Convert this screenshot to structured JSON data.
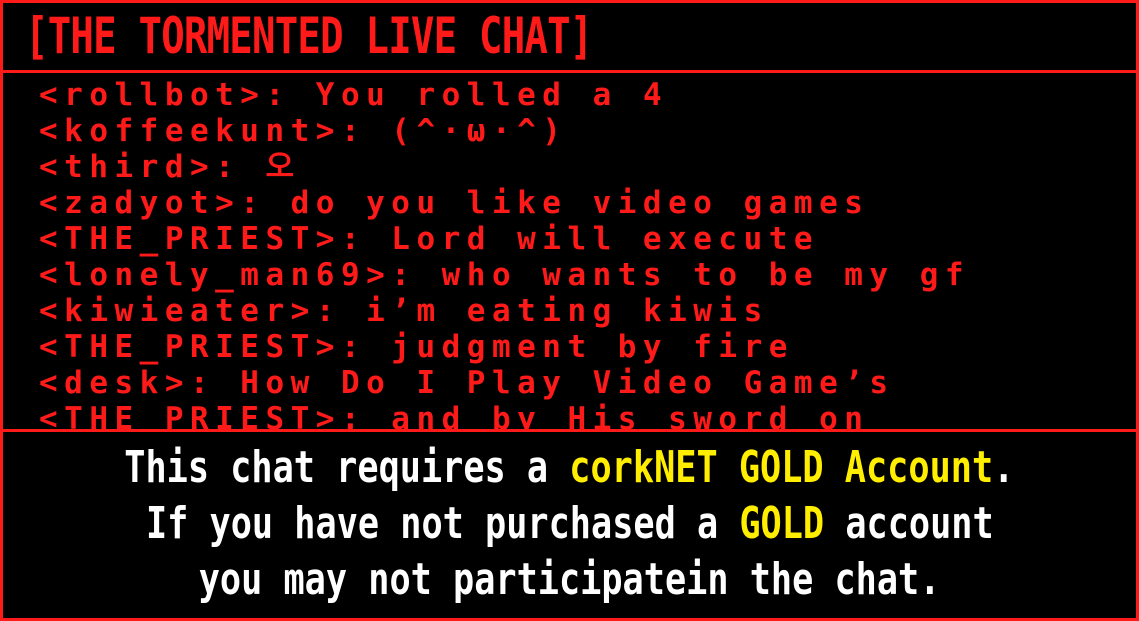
{
  "title": "[THE TORMENTED LIVE CHAT]",
  "messages": [
    {
      "user": "<rollbot>",
      "text": ": You rolled a 4"
    },
    {
      "user": "<koffeekunt>",
      "text": ": (^·ω·^)"
    },
    {
      "user": "<third>",
      "text": ": 오"
    },
    {
      "user": "<zadyot>",
      "text": ": do you like video games"
    },
    {
      "user": "<THE_PRIEST>",
      "text": ": Lord will execute"
    },
    {
      "user": "<lonely_man69>",
      "text": ": who wants to be my gf"
    },
    {
      "user": "<kiwieater>",
      "text": ": i’m eating kiwis"
    },
    {
      "user": "<THE_PRIEST>",
      "text": ": judgment by fire"
    },
    {
      "user": "<desk>",
      "text": ": How Do I Play Video Game’s"
    },
    {
      "user": "<THE_PRIEST>",
      "text": ": and by His sword on"
    }
  ],
  "notice": {
    "line1_a": "This chat requires a ",
    "line1_gold": "corkNET GOLD Account",
    "line1_b": ".",
    "line2_a": "If you have not purchased a ",
    "line2_gold": "GOLD",
    "line2_b": " account",
    "line3": "you may not participatein the chat."
  },
  "colors": {
    "accent_red": "#ff1a1a",
    "gold": "#ffee00",
    "text_white": "#ffffff",
    "background": "#000000"
  }
}
